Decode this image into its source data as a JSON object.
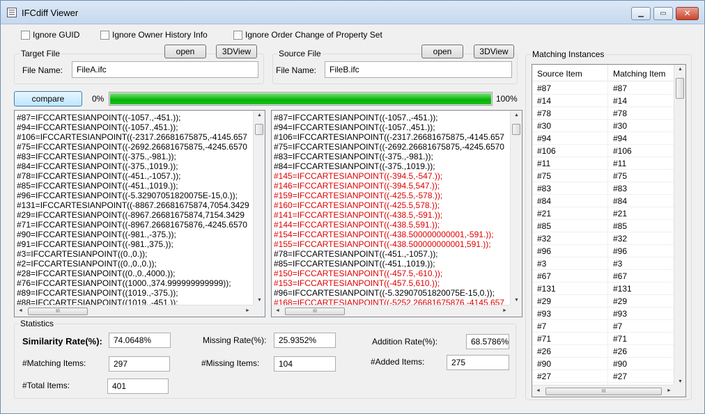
{
  "window": {
    "title": "IFCdiff Viewer",
    "minimize_label": "▁",
    "maximize_label": "▭",
    "close_label": "✕"
  },
  "options": {
    "ignore_guid": "Ignore GUID",
    "ignore_owner_history": "Ignore Owner History Info",
    "ignore_order_change": "Ignore Order Change of Property Set"
  },
  "target": {
    "group_label": "Target File",
    "open_label": "open",
    "view_label": "3DView",
    "file_name_label": "File Name:",
    "file_name": "FileA.ifc"
  },
  "source": {
    "group_label": "Source File",
    "open_label": "open",
    "view_label": "3DView",
    "file_name_label": "File Name:",
    "file_name": "FileB.ifc"
  },
  "compare": {
    "button_label": "compare",
    "progress_min_label": "0%",
    "progress_max_label": "100%",
    "progress_value": 1.0,
    "progress_color": "#06b006"
  },
  "diff_color": "#e00000",
  "target_lines": [
    "#87=IFCCARTESIANPOINT((-1057.,-451.));",
    "#94=IFCCARTESIANPOINT((-1057.,451.));",
    "#106=IFCCARTESIANPOINT((-2317.26681675875,-4145.657",
    "#75=IFCCARTESIANPOINT((-2692.26681675875,-4245.6570",
    "#83=IFCCARTESIANPOINT((-375.,-981.));",
    "#84=IFCCARTESIANPOINT((-375.,1019.));",
    "#78=IFCCARTESIANPOINT((-451.,-1057.));",
    "#85=IFCCARTESIANPOINT((-451.,1019.));",
    "#96=IFCCARTESIANPOINT((-5.32907051820075E-15,0.));",
    "#131=IFCCARTESIANPOINT((-8867.26681675874,7054.3429",
    "#29=IFCCARTESIANPOINT((-8967.26681675874,7154.3429",
    "#71=IFCCARTESIANPOINT((-8967.26681675876,-4245.6570",
    "#90=IFCCARTESIANPOINT((-981.,-375.));",
    "#91=IFCCARTESIANPOINT((-981.,375.));",
    "#3=IFCCARTESIANPOINT((0.,0.));",
    "#2=IFCCARTESIANPOINT((0.,0.,0.));",
    "#28=IFCCARTESIANPOINT((0.,0.,4000.));",
    "#76=IFCCARTESIANPOINT((1000.,374.999999999999));",
    "#89=IFCCARTESIANPOINT((1019.,-375.));",
    "#88=IFCCARTESIANPOINT((1019.,-451.));"
  ],
  "source_lines": [
    {
      "text": "#87=IFCCARTESIANPOINT((-1057.,-451.));",
      "diff": false
    },
    {
      "text": "#94=IFCCARTESIANPOINT((-1057.,451.));",
      "diff": false
    },
    {
      "text": "#106=IFCCARTESIANPOINT((-2317.26681675875,-4145.657",
      "diff": false
    },
    {
      "text": "#75=IFCCARTESIANPOINT((-2692.26681675875,-4245.6570",
      "diff": false
    },
    {
      "text": "#83=IFCCARTESIANPOINT((-375.,-981.));",
      "diff": false
    },
    {
      "text": "#84=IFCCARTESIANPOINT((-375.,1019.));",
      "diff": false
    },
    {
      "text": "#145=IFCCARTESIANPOINT((-394.5,-547.));",
      "diff": true
    },
    {
      "text": "#146=IFCCARTESIANPOINT((-394.5,547.));",
      "diff": true
    },
    {
      "text": "#159=IFCCARTESIANPOINT((-425.5,-578.));",
      "diff": true
    },
    {
      "text": "#160=IFCCARTESIANPOINT((-425.5,578.));",
      "diff": true
    },
    {
      "text": "#141=IFCCARTESIANPOINT((-438.5,-591.));",
      "diff": true
    },
    {
      "text": "#144=IFCCARTESIANPOINT((-438.5,591.));",
      "diff": true
    },
    {
      "text": "#154=IFCCARTESIANPOINT((-438.500000000001,-591.));",
      "diff": true
    },
    {
      "text": "#155=IFCCARTESIANPOINT((-438.500000000001,591.));",
      "diff": true
    },
    {
      "text": "#78=IFCCARTESIANPOINT((-451.,-1057.));",
      "diff": false
    },
    {
      "text": "#85=IFCCARTESIANPOINT((-451.,1019.));",
      "diff": false
    },
    {
      "text": "#150=IFCCARTESIANPOINT((-457.5,-610.));",
      "diff": true
    },
    {
      "text": "#153=IFCCARTESIANPOINT((-457.5,610.));",
      "diff": true
    },
    {
      "text": "#96=IFCCARTESIANPOINT((-5.32907051820075E-15,0.));",
      "diff": false
    },
    {
      "text": "#168=IFCCARTESIANPOINT((-5252.26681675876,-4145.657",
      "diff": true
    }
  ],
  "statistics": {
    "group_label": "Statistics",
    "similarity_label": "Similarity Rate(%):",
    "similarity_value": "74.0648%",
    "missing_rate_label": "Missing Rate(%):",
    "missing_rate_value": "25.9352%",
    "addition_rate_label": "Addition Rate(%):",
    "addition_rate_value": "68.5786%",
    "matching_label": "#Matching Items:",
    "matching_value": "297",
    "missing_label": "#Missing Items:",
    "missing_value": "104",
    "added_label": "#Added Items:",
    "added_value": "275",
    "total_label": "#Total Items:",
    "total_value": "401"
  },
  "matching": {
    "group_label": "Matching Instances",
    "columns": [
      "Source Item",
      "Matching Item"
    ],
    "rows": [
      [
        "#87",
        "#87"
      ],
      [
        "#14",
        "#14"
      ],
      [
        "#78",
        "#78"
      ],
      [
        "#30",
        "#30"
      ],
      [
        "#94",
        "#94"
      ],
      [
        "#106",
        "#106"
      ],
      [
        "#11",
        "#11"
      ],
      [
        "#75",
        "#75"
      ],
      [
        "#83",
        "#83"
      ],
      [
        "#84",
        "#84"
      ],
      [
        "#21",
        "#21"
      ],
      [
        "#85",
        "#85"
      ],
      [
        "#32",
        "#32"
      ],
      [
        "#96",
        "#96"
      ],
      [
        "#3",
        "#3"
      ],
      [
        "#67",
        "#67"
      ],
      [
        "#131",
        "#131"
      ],
      [
        "#29",
        "#29"
      ],
      [
        "#93",
        "#93"
      ],
      [
        "#7",
        "#7"
      ],
      [
        "#71",
        "#71"
      ],
      [
        "#26",
        "#26"
      ],
      [
        "#90",
        "#90"
      ],
      [
        "#27",
        "#27"
      ]
    ]
  },
  "scroll": {
    "up": "▲",
    "down": "▼",
    "left": "◄",
    "right": "►",
    "grip": "III"
  }
}
